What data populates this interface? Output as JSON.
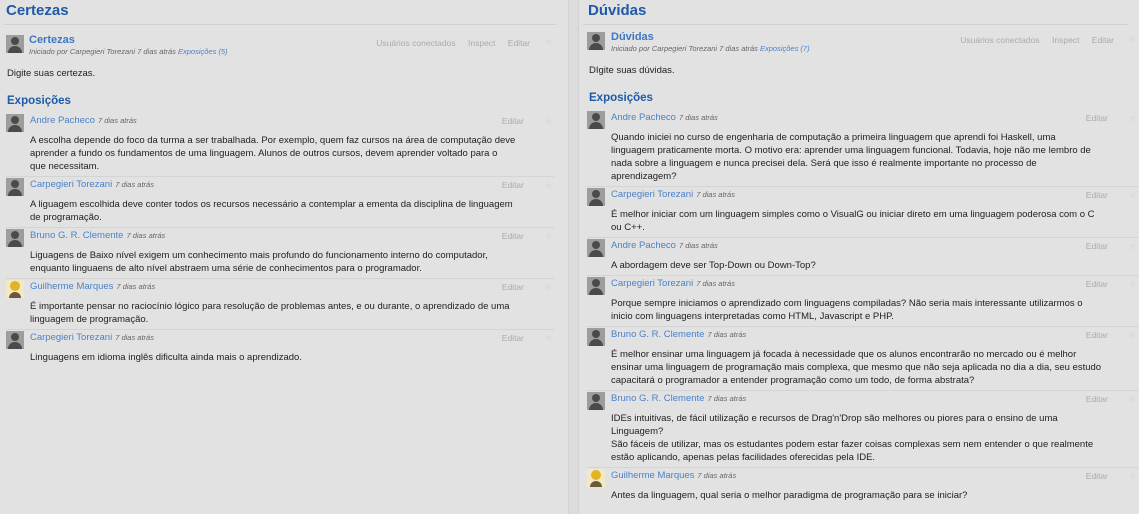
{
  "left": {
    "heading": "Certezas",
    "topic": {
      "title": "Certezas",
      "meta_prefix": "Iniciado por Carpegieri Torezani 7 dias atrás",
      "meta_link": "Exposições (5)",
      "actions": [
        "Usuários conectados",
        "Inspect",
        "Editar"
      ],
      "body": "Digite suas certezas."
    },
    "section": "Exposições",
    "posts": [
      {
        "author": "Andre Pacheco",
        "time": "7 dias atrás",
        "edit": "Editar",
        "avatar": "person",
        "lines": [
          "A escolha depende do foco da turma a ser trabalhada. Por exemplo, quem faz cursos na área de computação deve",
          "aprender a fundo os fundamentos de uma linguagem. Alunos de outros cursos, devem aprender voltado para o",
          "que  necessitam."
        ]
      },
      {
        "author": "Carpegieri Torezani",
        "time": "7 dias atrás",
        "edit": "Editar",
        "avatar": "person",
        "lines": [
          "A liguagem escolhida deve conter todos os recursos necessário a contemplar a ementa da disciplina de linguagem",
          "de programação."
        ]
      },
      {
        "author": "Bruno G. R. Clemente",
        "time": "7 dias atrás",
        "edit": "Editar",
        "avatar": "person",
        "lines": [
          "Liguagens de Baixo nível exigem um conhecimento mais profundo do funcionamento interno do computador,",
          "enquanto linguaens de alto nível abstraem uma série de conhecimentos para o programador."
        ]
      },
      {
        "author": "Guilherme Marques",
        "time": "7 dias atrás",
        "edit": "Editar",
        "avatar": "cartoon",
        "lines": [
          "É importante pensar no raciocínio lógico para resolução de problemas antes, e ou durante, o aprendizado de uma",
          "linguagem de programação."
        ]
      },
      {
        "author": "Carpegieri Torezani",
        "time": "7 dias atrás",
        "edit": "Editar",
        "avatar": "person",
        "lines": [
          "Linguagens em idioma inglês dificulta ainda mais o aprendizado."
        ]
      }
    ]
  },
  "right": {
    "heading": "Dúvidas",
    "topic": {
      "title": "Dúvidas",
      "meta_prefix": "Iniciado por Carpegieri Torezani 7 dias atrás",
      "meta_link": "Exposições (7)",
      "actions": [
        "Usuários conectados",
        "Inspect",
        "Editar"
      ],
      "body": "DIgite suas dúvidas."
    },
    "section": "Exposições",
    "posts": [
      {
        "author": "Andre Pacheco",
        "time": "7 dias atrás",
        "edit": "Editar",
        "avatar": "person",
        "lines": [
          "Quando iniciei no curso de engenharia de computação a primeira linguagem que aprendi foi Haskell, uma",
          "linguagem praticamente morta. O motivo era: aprender uma linguagem funcional. Todavia, hoje não me lembro de",
          "nada sobre a linguagem e nunca precisei dela. Será que isso é realmente importante no processo de",
          "aprendizagem?"
        ]
      },
      {
        "author": "Carpegieri Torezani",
        "time": "7 dias atrás",
        "edit": "Editar",
        "avatar": "person",
        "lines": [
          "É melhor iniciar com um linguagem simples como o VisualG ou iniciar direto em uma linguagem poderosa com o C",
          "ou C++."
        ]
      },
      {
        "author": "Andre Pacheco",
        "time": "7 dias atrás",
        "edit": "Editar",
        "avatar": "person",
        "lines": [
          "A abordagem deve ser Top-Down ou Down-Top?"
        ]
      },
      {
        "author": "Carpegieri Torezani",
        "time": "7 dias atrás",
        "edit": "Editar",
        "avatar": "person",
        "lines": [
          "Porque sempre iniciamos o aprendizado com linguagens compiladas? Não seria mais interessante utilizarmos o",
          "inicio com linguagens interpretadas como HTML, Javascript e PHP."
        ]
      },
      {
        "author": "Bruno G. R. Clemente",
        "time": "7 dias atrás",
        "edit": "Editar",
        "avatar": "person",
        "lines": [
          "É melhor ensinar uma linguagem já focada à necessidade que os alunos encontrarão no mercado ou é melhor",
          "ensinar uma linguagem de programação mais complexa, que mesmo que não seja aplicada no dia a dia, seu estudo",
          "capacitará o programador a entender programação como um todo, de forma abstrata?"
        ]
      },
      {
        "author": "Bruno G. R. Clemente",
        "time": "7 dias atrás",
        "edit": "Editar",
        "avatar": "person",
        "lines": [
          "IDEs intuitivas, de fácil utilização e recursos de Drag'n'Drop são melhores ou piores para o ensino de uma",
          "Linguagem?",
          "São fáceis de utilizar, mas os estudantes podem estar fazer coisas complexas sem nem entender o que realmente",
          "estão aplicando, apenas pelas facilidades oferecidas pela IDE."
        ]
      },
      {
        "author": "Guilherme Marques",
        "time": "7 dias atrás",
        "edit": "Editar",
        "avatar": "cartoon",
        "lines": [
          "Antes da linguagem, qual seria o melhor paradigma de programação para se iniciar?"
        ]
      }
    ]
  }
}
